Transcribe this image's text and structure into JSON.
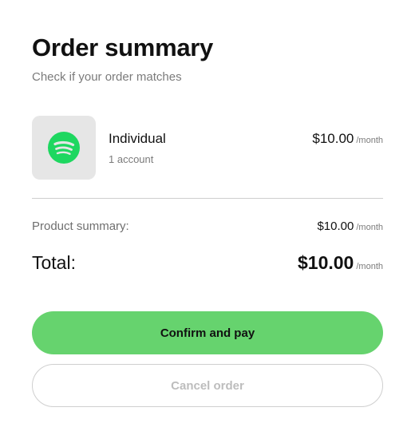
{
  "header": {
    "title": "Order summary",
    "subtitle": "Check if your order matches"
  },
  "product": {
    "icon": "spotify-logo-icon",
    "name": "Individual",
    "detail": "1 account",
    "price": "$10.00",
    "period": "/month"
  },
  "summary": {
    "label": "Product summary:",
    "price": "$10.00",
    "period": "/month"
  },
  "total": {
    "label": "Total:",
    "price": "$10.00",
    "period": "/month"
  },
  "actions": {
    "confirm_label": "Confirm and pay",
    "cancel_label": "Cancel order"
  },
  "colors": {
    "accent": "#66d36e",
    "brand_logo": "#1ed760",
    "muted_text": "#7b7b7b"
  }
}
